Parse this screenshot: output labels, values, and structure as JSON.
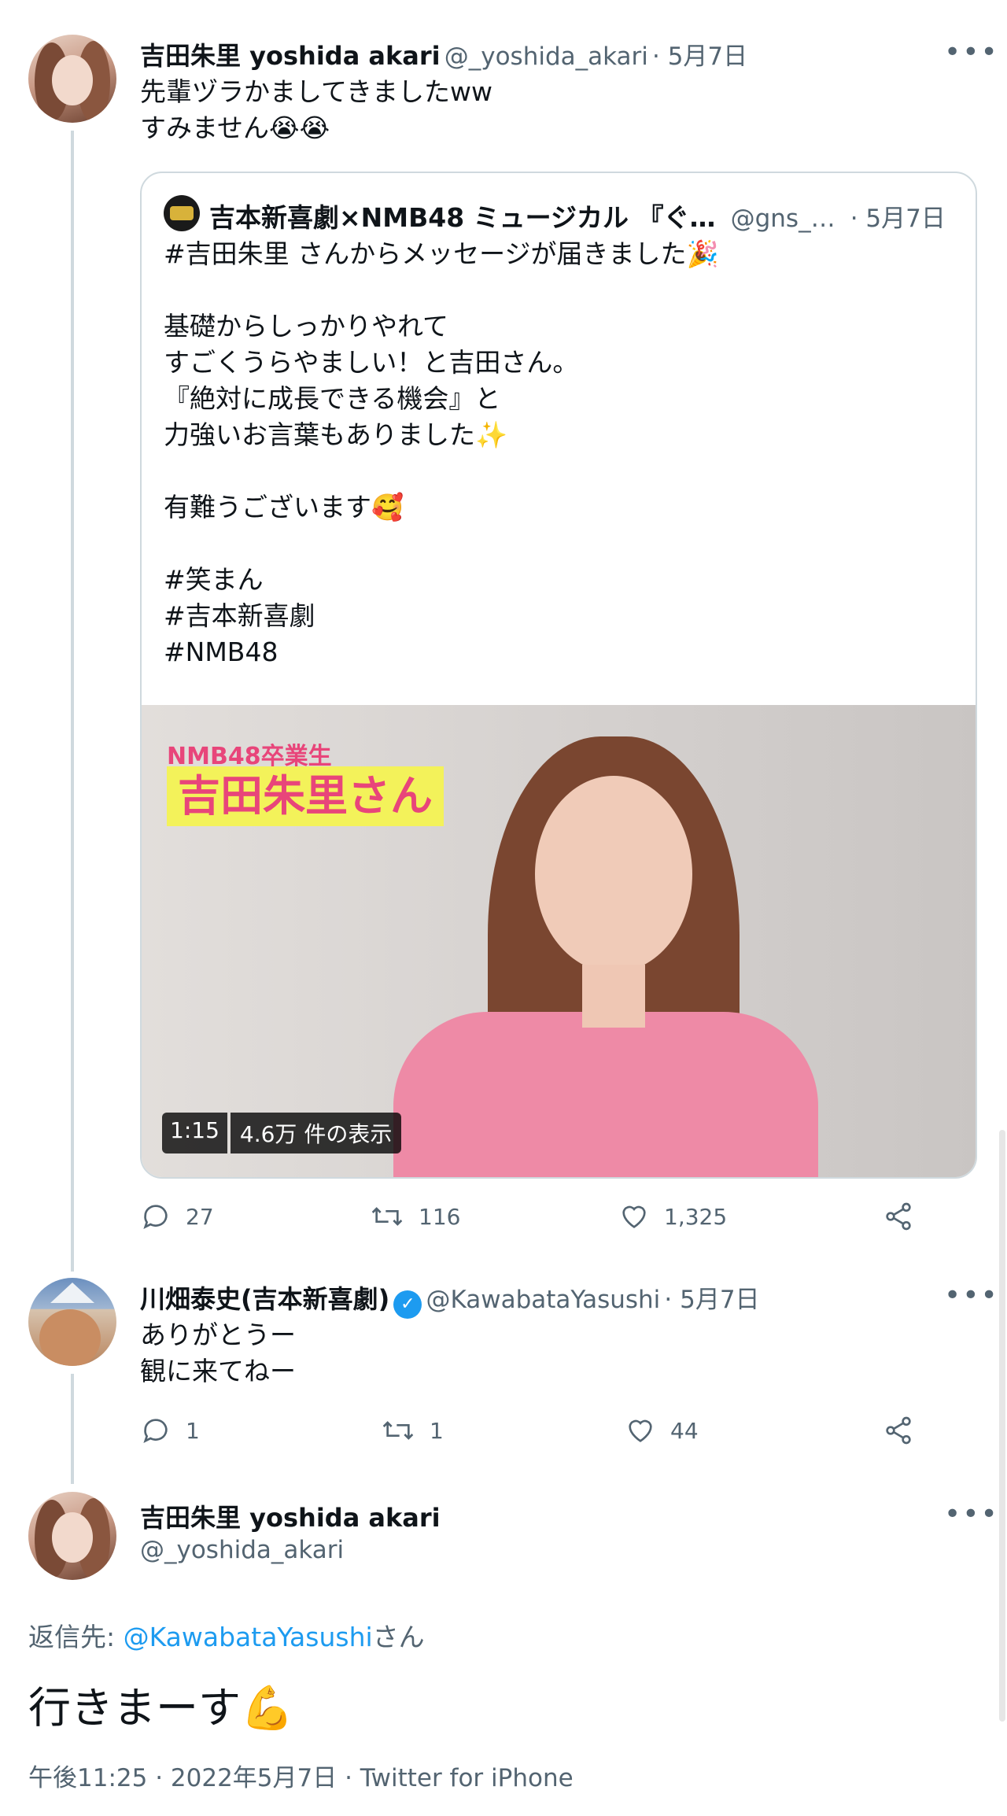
{
  "tweet1": {
    "name": "吉田朱里 yoshida akari",
    "handle": "@_yoshida_akari",
    "date": "· 5月7日",
    "text": "先輩ヅラかましてきましたww\nすみません😭😭",
    "quote": {
      "name": "吉本新喜劇×NMB48 ミュージカル 『ぐ…",
      "handle": "@gns_…",
      "date": "· 5月7日",
      "text": "#吉田朱里 さんからメッセージが届きました🎉\n\n基礎からしっかりやれて\nすごくうらやましい！と吉田さん。\n『絶対に成長できる機会』と\n力強いお言葉もありました✨\n\n有難うございます🥰\n\n#笑まん\n#吉本新喜劇\n#NMB48",
      "video": {
        "caption_small": "NMB48卒業生",
        "caption_big": "吉田朱里さん",
        "duration": "1:15",
        "views": "4.6万 件の表示"
      }
    },
    "stats": {
      "replies": "27",
      "retweets": "116",
      "likes": "1,325"
    }
  },
  "tweet2": {
    "name": "川畑泰史(吉本新喜劇)",
    "verified_badge": "✓",
    "handle": "@KawabataYasushi",
    "date": "· 5月7日",
    "text": "ありがとうー\n観に来てねー",
    "stats": {
      "replies": "1",
      "retweets": "1",
      "likes": "44"
    }
  },
  "tweet3": {
    "name": "吉田朱里 yoshida akari",
    "handle": "@_yoshida_akari",
    "reply_prefix": "返信先: ",
    "reply_to": "@KawabataYasushi",
    "reply_suffix": "さん",
    "text": "行きまーす💪",
    "timestamp": "午後11:25 · 2022年5月7日 · Twitter for iPhone"
  },
  "more_glyph": "•••",
  "colors": {
    "accent": "#1d9bf0",
    "text": "#0f1419",
    "muted": "#536471",
    "border": "#cfd9de"
  }
}
